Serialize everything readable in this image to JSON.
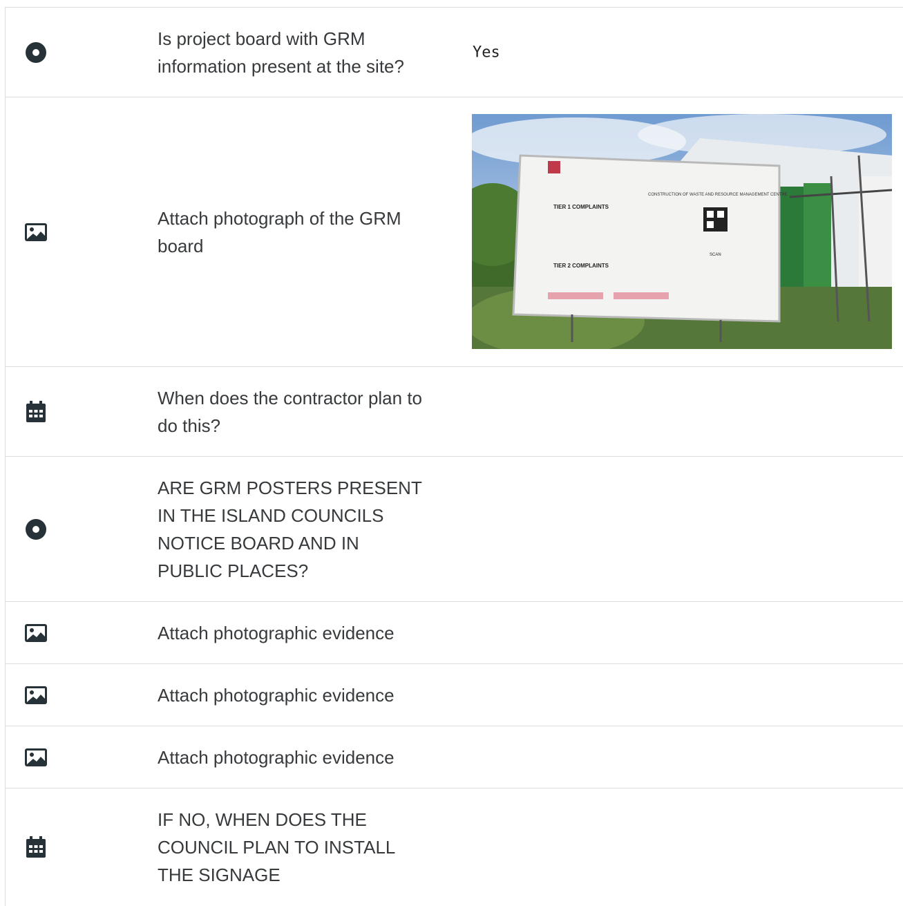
{
  "colors": {
    "icon": "#263238",
    "border": "#dcdcdc",
    "text": "#373a3c"
  },
  "rows": [
    {
      "icon": "radio-icon",
      "question": "Is project board with GRM information present at the site?",
      "answer": "Yes"
    },
    {
      "icon": "image-icon",
      "question": "Attach photograph of the GRM board",
      "photo_alt": "GRM board photograph"
    },
    {
      "icon": "calendar-icon",
      "question": "When does the contractor plan to do this?"
    },
    {
      "icon": "radio-icon",
      "question": "ARE GRM POSTERS PRESENT IN THE ISLAND COUNCILS NOTICE BOARD AND IN PUBLIC PLACES?"
    },
    {
      "icon": "image-icon",
      "question": "Attach photographic evidence"
    },
    {
      "icon": "image-icon",
      "question": "Attach photographic evidence"
    },
    {
      "icon": "image-icon",
      "question": "Attach photographic evidence"
    },
    {
      "icon": "calendar-icon",
      "question": "IF NO, WHEN DOES THE COUNCIL PLAN TO INSTALL THE SIGNAGE"
    }
  ],
  "photo_board": {
    "heading": "CONSTRUCTION OF WASTE AND RESOURCE MANAGEMENT CENTRE",
    "tier1": "TIER 1 COMPLAINTS",
    "tier2": "TIER 2 COMPLAINTS",
    "scan": "SCAN"
  }
}
